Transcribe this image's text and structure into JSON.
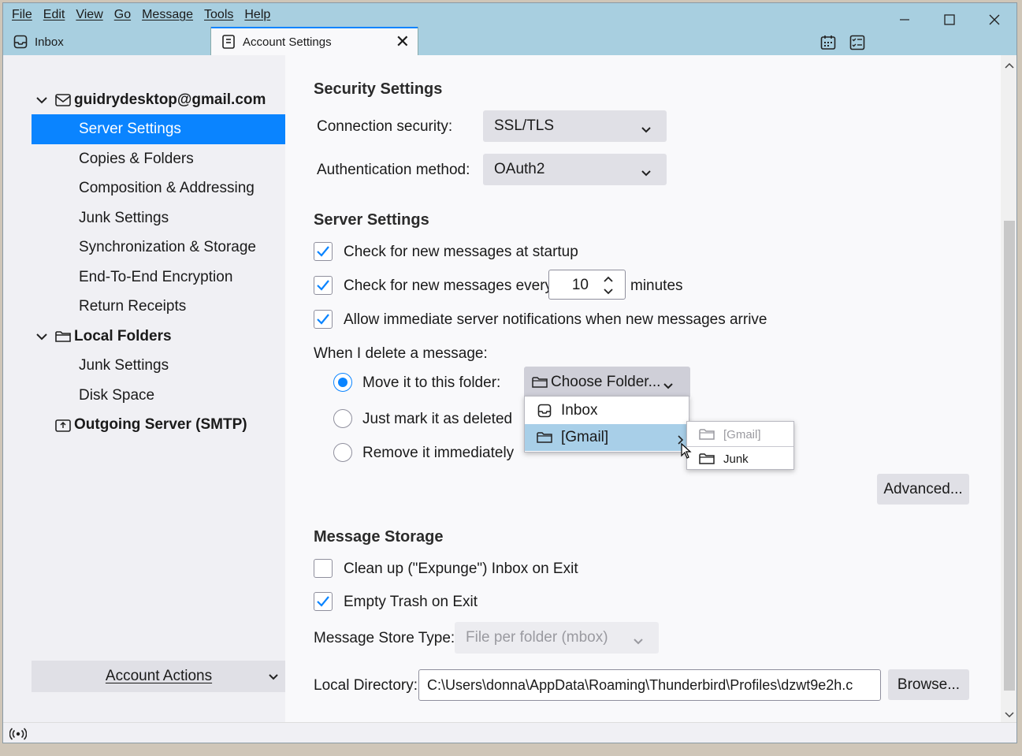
{
  "menu": [
    "File",
    "Edit",
    "View",
    "Go",
    "Message",
    "Tools",
    "Help"
  ],
  "tabs": {
    "inbox": "Inbox",
    "settings": "Account Settings",
    "close": "✕"
  },
  "sidebar": {
    "account": "guidrydesktop@gmail.com",
    "account_items": [
      "Server Settings",
      "Copies & Folders",
      "Composition & Addressing",
      "Junk Settings",
      "Synchronization & Storage",
      "End-To-End Encryption",
      "Return Receipts"
    ],
    "local_folders": "Local Folders",
    "local_items": [
      "Junk Settings",
      "Disk Space"
    ],
    "outgoing": "Outgoing Server (SMTP)",
    "account_actions": "Account Actions"
  },
  "security": {
    "heading": "Security Settings",
    "connection_label": "Connection security:",
    "connection_value": "SSL/TLS",
    "auth_label": "Authentication method:",
    "auth_value": "OAuth2"
  },
  "server": {
    "heading": "Server Settings",
    "check_startup": "Check for new messages at startup",
    "check_every": "Check for new messages every",
    "minutes_value": "10",
    "minutes": "minutes",
    "allow_notifications": "Allow immediate server notifications when new messages arrive",
    "delete_label": "When I delete a message:",
    "move_to_folder": "Move it to this folder:",
    "choose_folder": "Choose Folder...",
    "mark_deleted": "Just mark it as deleted",
    "remove_immediately": "Remove it immediately",
    "advanced": "Advanced..."
  },
  "folder_popup": {
    "items": [
      "Inbox",
      "[Gmail]"
    ],
    "submenu": [
      "[Gmail]",
      "Junk"
    ]
  },
  "storage": {
    "heading": "Message Storage",
    "expunge": "Clean up (\"Expunge\") Inbox on Exit",
    "empty_trash": "Empty Trash on Exit",
    "store_type_label": "Message Store Type:",
    "store_type_value": "File per folder (mbox)",
    "local_dir_label": "Local Directory:",
    "local_dir_value": "C:\\Users\\donna\\AppData\\Roaming\\Thunderbird\\Profiles\\dzwt9e2h.c",
    "browse": "Browse..."
  },
  "colors": {
    "accent": "#0a84ff",
    "titlebar": "#a8cfe0",
    "highlight": "#a8cfe8"
  },
  "checkboxes": {
    "check_startup": true,
    "check_every": true,
    "allow_notifications": true,
    "expunge": false,
    "empty_trash": true
  }
}
